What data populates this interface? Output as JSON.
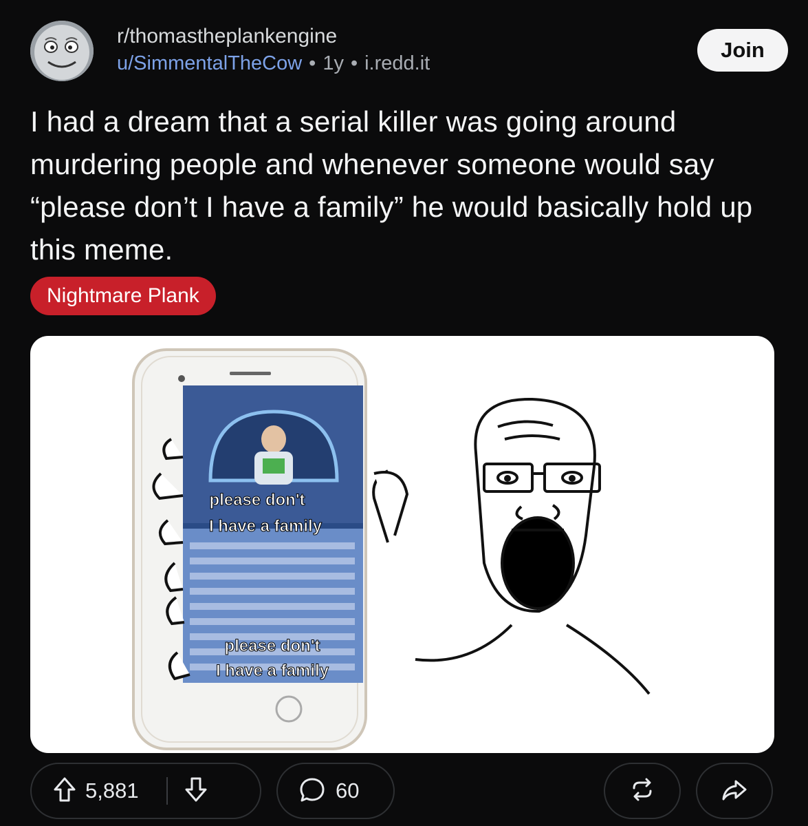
{
  "post": {
    "subreddit": "r/thomastheplankengine",
    "username": "u/SimmentalTheCow",
    "age": "1y",
    "domain": "i.redd.it",
    "separator": "•",
    "join_label": "Join",
    "title": "I had a dream that a serial killer was going around murdering people and whenever someone would say “please don’t I have a family” he would basically hold up this meme.",
    "flair": "Nightmare Plank",
    "flair_color": "#c8202a"
  },
  "media": {
    "caption_top_line1": "please don't",
    "caption_top_line2": "I have a family",
    "caption_bottom_line1": "please don't",
    "caption_bottom_line2": "I have a family"
  },
  "actions": {
    "upvotes": "5,881",
    "comments": "60",
    "upvote_icon": "arrow-up-icon",
    "downvote_icon": "arrow-down-icon",
    "comment_icon": "speech-bubble-icon",
    "crosspost_icon": "crosspost-icon",
    "share_icon": "share-arrow-icon"
  },
  "colors": {
    "background": "#0b0b0c",
    "username": "#7da2e8",
    "join_button": "#f4f4f5"
  }
}
